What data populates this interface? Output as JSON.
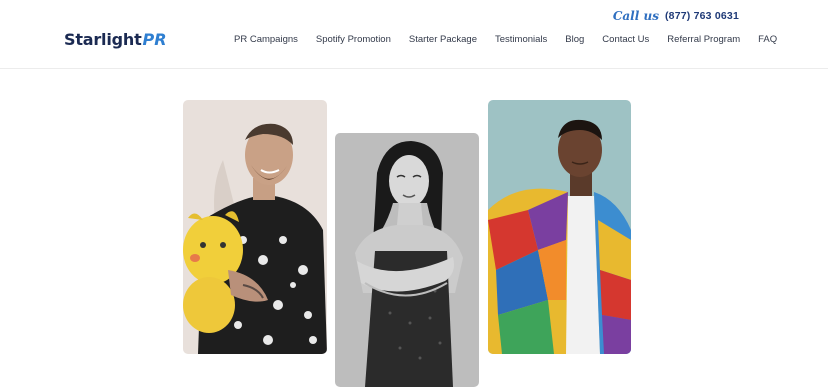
{
  "brand": {
    "name_main": "Starlight",
    "name_accent": "PR"
  },
  "contact": {
    "call_label": "Call us",
    "phone": "(877) 763 0631"
  },
  "nav": {
    "items": [
      "PR Campaigns",
      "Spotify Promotion",
      "Starter Package",
      "Testimonials",
      "Blog",
      "Contact Us",
      "Referral Program",
      "FAQ"
    ]
  },
  "colors": {
    "brand_navy": "#1b2a52",
    "brand_blue": "#2f7fd1",
    "brand_green": "#3aa655",
    "card1_bg": "#e7dfda",
    "card2_bg": "#bdbdbd",
    "card3_bg": "#9ec1c3"
  },
  "cards": [
    {
      "icon": "artist-photo-tattooed-man-with-yellow-plush"
    },
    {
      "icon": "artist-photo-woman-black-and-white"
    },
    {
      "icon": "artist-photo-man-colorful-jacket"
    }
  ]
}
